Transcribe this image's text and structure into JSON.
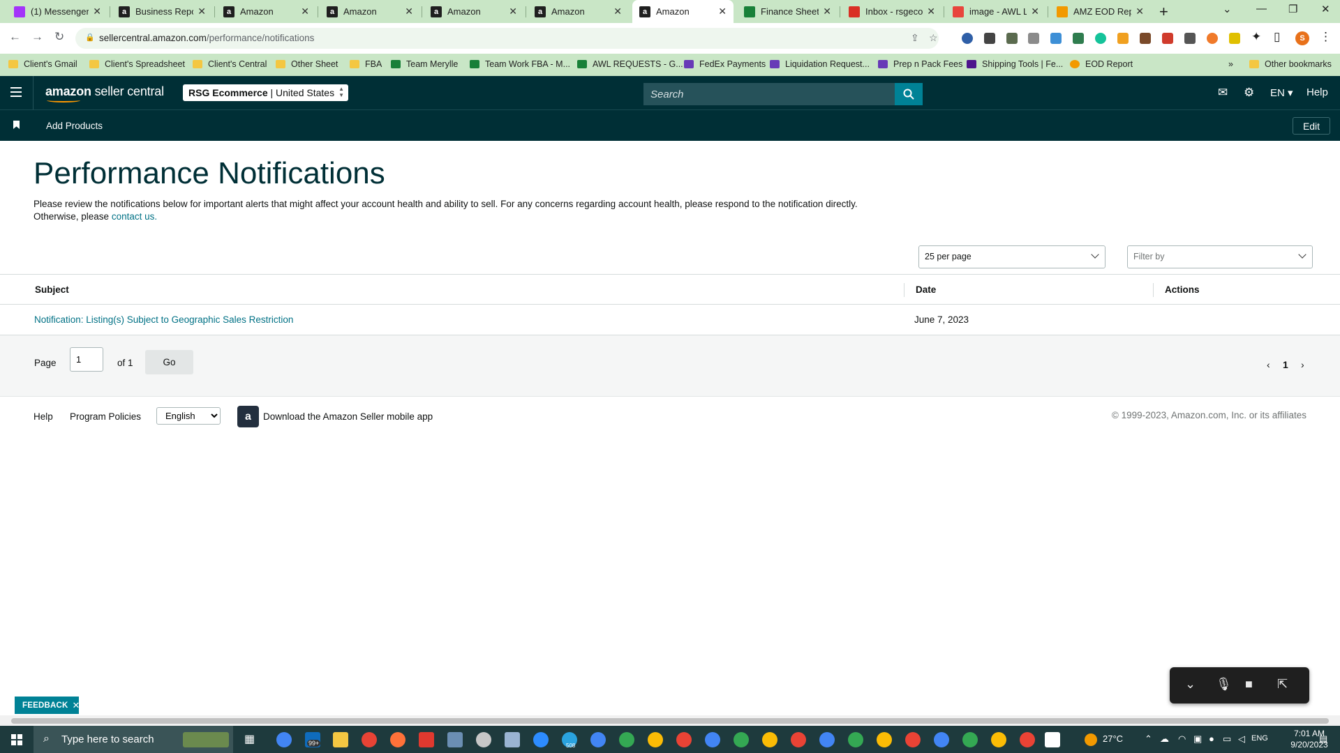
{
  "browser": {
    "tabs": [
      {
        "title": "(1) Messenger",
        "favicon": "messenger-icon",
        "color": "#a334fa"
      },
      {
        "title": "Business Reports",
        "favicon": "amazon-icon",
        "color": "#1f1f1f"
      },
      {
        "title": "Amazon",
        "favicon": "amazon-icon",
        "color": "#1f1f1f"
      },
      {
        "title": "Amazon",
        "favicon": "amazon-icon",
        "color": "#1f1f1f"
      },
      {
        "title": "Amazon",
        "favicon": "amazon-icon",
        "color": "#1f1f1f"
      },
      {
        "title": "Amazon",
        "favicon": "amazon-icon",
        "color": "#1f1f1f"
      },
      {
        "title": "Amazon",
        "favicon": "amazon-icon",
        "color": "#1f1f1f"
      },
      {
        "title": "Finance Sheet -",
        "favicon": "sheets-icon",
        "color": "#188038"
      },
      {
        "title": "Inbox - rsgecom",
        "favicon": "gmail-icon",
        "color": "#d93025"
      },
      {
        "title": "image - AWL LA",
        "favicon": "clickup-icon",
        "color": "#e8453c"
      },
      {
        "title": "AMZ EOD Repo",
        "favicon": "eod-icon",
        "color": "#f29900"
      }
    ],
    "active_tab": 6,
    "url_domain": "sellercentral.amazon.com",
    "url_path": "/performance/notifications",
    "profile_initial": "S",
    "bookmarks": [
      {
        "label": "Client's Gmail",
        "icon": "folder"
      },
      {
        "label": "Client's Spreadsheet",
        "icon": "folder"
      },
      {
        "label": "Client's Central",
        "icon": "folder"
      },
      {
        "label": "Other Sheet",
        "icon": "folder"
      },
      {
        "label": "FBA",
        "icon": "folder"
      },
      {
        "label": "Team Merylle",
        "icon": "sheet"
      },
      {
        "label": "Team Work FBA - M...",
        "icon": "sheet"
      },
      {
        "label": "AWL REQUESTS - G...",
        "icon": "sheet"
      },
      {
        "label": "FedEx Payments",
        "icon": "form"
      },
      {
        "label": "Liquidation Request...",
        "icon": "form"
      },
      {
        "label": "Prep n Pack Fees",
        "icon": "form"
      },
      {
        "label": "Shipping Tools | Fe...",
        "icon": "fedex"
      },
      {
        "label": "EOD Report",
        "icon": "eod"
      }
    ],
    "other_bookmarks": "Other bookmarks"
  },
  "header": {
    "logo_text_bold": "amazon",
    "logo_text": " seller central",
    "account_name": "RSG Ecommerce",
    "account_region": "United States",
    "search_placeholder": "Search",
    "language": "EN",
    "help": "Help",
    "subnav_link": "Add Products",
    "edit_label": "Edit"
  },
  "main": {
    "title": "Performance Notifications",
    "intro_text": "Please review the notifications below for important alerts that might affect your account health and ability to sell. For any concerns regarding account health, please respond to the notification directly. Otherwise, please ",
    "intro_link": "contact us.",
    "per_page": "25 per page",
    "filter_placeholder": "Filter by",
    "columns": [
      "Subject",
      "Date",
      "Actions"
    ],
    "rows": [
      {
        "subject": "Notification: Listing(s) Subject to Geographic Sales Restriction",
        "date": "June 7, 2023",
        "actions": ""
      }
    ],
    "pager": {
      "page_label": "Page",
      "page_value": "1",
      "of_label": "of 1",
      "go_label": "Go",
      "current_page": "1"
    }
  },
  "footer": {
    "help": "Help",
    "program_policies": "Program Policies",
    "language": "English",
    "app_text": "Download the Amazon Seller mobile app",
    "copyright": "© 1999-2023, Amazon.com, Inc. or its affiliates"
  },
  "feedback": "FEEDBACK",
  "taskbar": {
    "search_placeholder": "Type here to search",
    "mail_badge": "99+",
    "telegram_badge": "508",
    "temperature": "27°C",
    "time": "7:01 AM",
    "date": "9/20/2023"
  },
  "colors": {
    "header_bg": "#002f36",
    "accent": "#008296",
    "link": "#007185",
    "browser_green": "#c9e6c6"
  }
}
